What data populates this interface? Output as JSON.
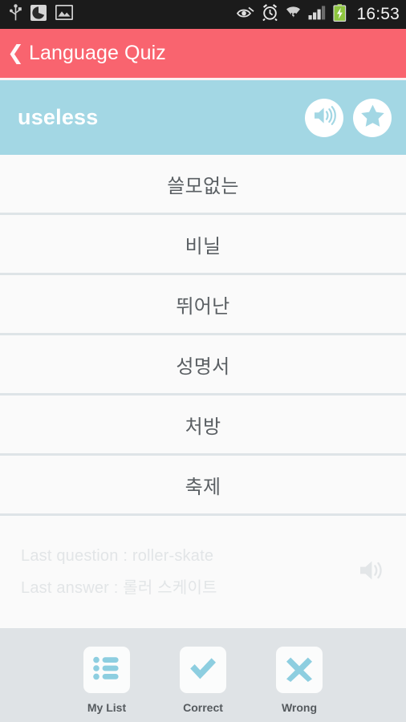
{
  "statusbar": {
    "time": "16:53",
    "left_icons": [
      "usb-icon",
      "app-circle-icon",
      "gallery-image-icon"
    ],
    "right_icons": [
      "eye-smart-stay-icon",
      "alarm-clock-icon",
      "wifi-icon",
      "signal-bars-icon",
      "battery-charging-icon"
    ]
  },
  "appbar": {
    "back_label": "❮",
    "title": "Language Quiz",
    "background_color": "#f9646f"
  },
  "question": {
    "word": "useless",
    "background_color": "#a3d7e4",
    "speak_icon": "speaker-icon",
    "favorite_icon": "star-icon"
  },
  "options": [
    {
      "text": "쓸모없는"
    },
    {
      "text": "비닐"
    },
    {
      "text": "뛰어난"
    },
    {
      "text": "성명서"
    },
    {
      "text": "처방"
    },
    {
      "text": "축제"
    }
  ],
  "last": {
    "question_line": "Last question : roller-skate",
    "answer_line": "Last answer : 롤러 스케이트",
    "speak_icon": "speaker-icon"
  },
  "bottombar": {
    "items": [
      {
        "label": "My List",
        "icon": "list-icon"
      },
      {
        "label": "Correct",
        "icon": "check-icon"
      },
      {
        "label": "Wrong",
        "icon": "cross-icon"
      }
    ],
    "accent_color": "#8dcee0",
    "background_color": "#dfe3e6"
  }
}
